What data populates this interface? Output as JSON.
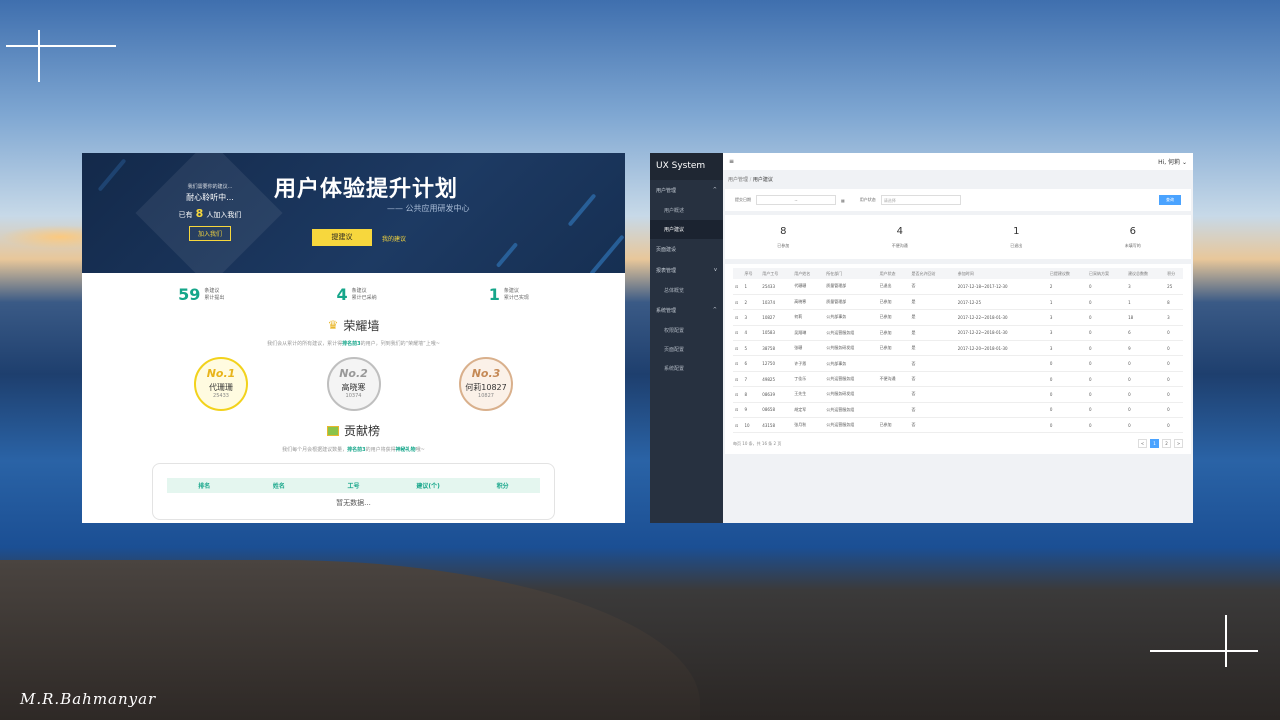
{
  "watermark": "M.R.Bahmanyar",
  "left": {
    "diamond": {
      "line1": "我们需要你的建议...",
      "line2": "耐心聆听中...",
      "pre": "已有",
      "count": "8",
      "post": "人加入我们",
      "join": "加入我们"
    },
    "title": "用户体验提升计划",
    "subtitle": "—— 公共应用研发中心",
    "suggest_btn": "提建议",
    "my_suggest": "我的建议",
    "stats": [
      {
        "num": "59",
        "l1": "条建议",
        "l2": "累计提出"
      },
      {
        "num": "4",
        "l1": "条建议",
        "l2": "累计已采纳"
      },
      {
        "num": "1",
        "l1": "条建议",
        "l2": "累计已实现"
      }
    ],
    "honor": {
      "title": "荣耀墙",
      "desc_pre": "我们会从累计的所有建议，累计得",
      "desc_hl": "排名前3",
      "desc_post": "的用户，列到我们的“荣耀墙”上哦~"
    },
    "medals": [
      {
        "no": "No.1",
        "name": "代珊珊",
        "id": "25433"
      },
      {
        "no": "No.2",
        "name": "高晓寒",
        "id": "10374"
      },
      {
        "no": "No.3",
        "name": "何莉10827",
        "id": "10827"
      }
    ],
    "contrib": {
      "title": "贡献榜",
      "desc_pre": "我们每个月会根据建议数量，",
      "desc_hl": "排名前3",
      "desc_mid": "的用户将获得",
      "desc_hl2": "神秘礼物",
      "desc_post": "哦~"
    },
    "table_headers": [
      "排名",
      "姓名",
      "工号",
      "建议(个)",
      "积分"
    ],
    "nodata": "暂无数据..."
  },
  "right": {
    "logo": "UX System",
    "menu": [
      {
        "label": "用户管理",
        "arrow": "^",
        "subs": [
          {
            "label": "用户概述",
            "active": false
          },
          {
            "label": "用户建议",
            "active": true
          }
        ]
      },
      {
        "label": "页面建设",
        "arrow": "",
        "subs": []
      },
      {
        "label": "报表管理",
        "arrow": "v",
        "subs": [
          {
            "label": "总体概览",
            "active": false
          }
        ]
      },
      {
        "label": "系统管理",
        "arrow": "^",
        "subs": [
          {
            "label": "权限配置",
            "active": false
          },
          {
            "label": "页面配置",
            "active": false
          },
          {
            "label": "系统配置",
            "active": false
          }
        ]
      }
    ],
    "menu_icon": "≡",
    "user": "Hi, 何莉 ⌄",
    "breadcrumb": {
      "a": "用户管理",
      "sep": "/",
      "b": "用户建议"
    },
    "filter": {
      "label1": "提交日期",
      "input1": "~",
      "label2": "用户状态",
      "input2": "请选择",
      "query": "查询"
    },
    "cards": [
      {
        "num": "8",
        "label": "已参加"
      },
      {
        "num": "4",
        "label": "不便沟通"
      },
      {
        "num": "1",
        "label": "已退出"
      },
      {
        "num": "6",
        "label": "未填写的"
      }
    ],
    "columns": [
      "",
      "序号",
      "用户工号",
      "用户姓名",
      "所在部门",
      "用户状态",
      "是否允许回访",
      "参加时间",
      "已提建议数",
      "已采纳方案",
      "建议总数数",
      "积分"
    ],
    "rows": [
      [
        "⊡",
        "1",
        "25433",
        "代珊珊",
        "质量管理部",
        "已退出",
        "否",
        "2017-12-18~2017-12-30",
        "2",
        "0",
        "3",
        "25"
      ],
      [
        "⊡",
        "2",
        "10374",
        "高晓寒",
        "质量管理部",
        "已参加",
        "是",
        "2017-12-25",
        "1",
        "0",
        "1",
        "8"
      ],
      [
        "⊡",
        "3",
        "10827",
        "何莉",
        "公共部事务",
        "已参加",
        "是",
        "2017-12-22~2018-01-30",
        "3",
        "0",
        "18",
        "3"
      ],
      [
        "⊡",
        "4",
        "10583",
        "吴翔琳",
        "公共运营服务组",
        "已参加",
        "是",
        "2017-12-22~2018-01-30",
        "3",
        "0",
        "6",
        "0"
      ],
      [
        "⊡",
        "5",
        "38758",
        "张珊",
        "公共服务研发组",
        "已参加",
        "是",
        "2017-12-20~2018-01-30",
        "3",
        "0",
        "9",
        "0"
      ],
      [
        "⊡",
        "6",
        "12750",
        "许子恩",
        "公共部事务",
        "",
        "否",
        "",
        "0",
        "0",
        "0",
        "0"
      ],
      [
        "⊡",
        "7",
        "49825",
        "丁佳乐",
        "公共运营服务组",
        "不便沟通",
        "否",
        "",
        "0",
        "0",
        "0",
        "0"
      ],
      [
        "⊡",
        "8",
        "08639",
        "王先生",
        "公共服务研发组",
        "",
        "否",
        "",
        "0",
        "0",
        "0",
        "0"
      ],
      [
        "⊡",
        "9",
        "08658",
        "胡定军",
        "公共运营服务组",
        "",
        "否",
        "",
        "0",
        "0",
        "0",
        "0"
      ],
      [
        "⊡",
        "10",
        "43158",
        "张月秋",
        "公共运营服务组",
        "已参加",
        "否",
        "",
        "0",
        "0",
        "0",
        "0"
      ]
    ],
    "pagination": {
      "summary": "每页 10 条，共 16 条 2 页",
      "prev": "<",
      "pages": [
        "1",
        "2"
      ],
      "next": ">"
    }
  }
}
